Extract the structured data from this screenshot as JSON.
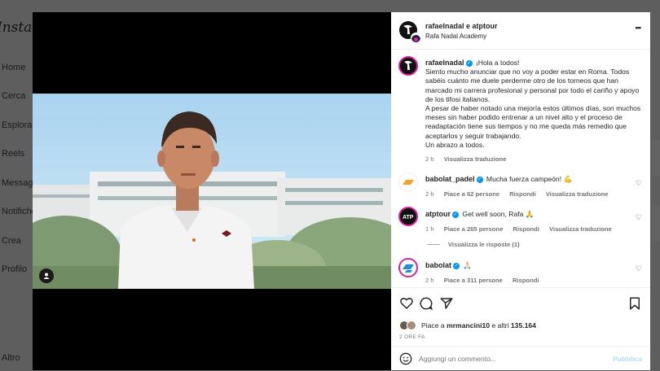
{
  "sidebar": {
    "logo": "Instagram",
    "items": [
      "Home",
      "Cerca",
      "Esplora",
      "Reels",
      "Messaggi",
      "Notifiche",
      "Crea",
      "Profilo",
      "Altro"
    ]
  },
  "post": {
    "author": "rafaelnadal e atptour",
    "location": "Rafa Nadal Academy",
    "more_label": "•••",
    "caption": {
      "user": "rafaelnadal",
      "lines": [
        "¡Hola a todos!",
        "Siento mucho anunciar que no voy a poder estar en Roma. Todos sabéis cuánto me duele perderme otro de los torneos que han marcado mi carrera profesional y personal por todo el cariño y apoyo de los tifosi italianos.",
        "A pesar de haber notado una mejoría estos últimos días, son muchos meses sin haber podido entrenar a un nivel alto y el proceso de readaptación tiene sus tiempos y no me queda más remedio que aceptarlos y seguir trabajando.",
        "Un abrazo a todos."
      ],
      "time": "2 h",
      "translate": "Visualizza traduzione"
    },
    "comments": [
      {
        "user": "babolat_padel",
        "text": "Mucha fuerza campeón! 💪",
        "time": "2 h",
        "likes": "Piace a 62 persone",
        "reply": "Rispondi",
        "translate": "Visualizza traduzione"
      },
      {
        "user": "atptour",
        "text": "Get well soon, Rafa 🙏",
        "time": "1 h",
        "likes": "Piace a 265 persone",
        "reply": "Rispondi",
        "translate": "Visualizza traduzione",
        "view_replies": "Visualizza le risposte (1)"
      },
      {
        "user": "babolat",
        "text": "🙏🏻",
        "time": "2 h",
        "likes": "Piace a 311 persone",
        "reply": "Rispondi"
      }
    ],
    "likes_prefix": "Piace a ",
    "likes_user": "mrmancini10",
    "likes_suffix": " e altri ",
    "likes_count": "135.164",
    "timestamp": "2 ORE FA",
    "add_comment_placeholder": "Aggiungi un commento...",
    "publish": "Pubblica"
  },
  "colors": {
    "accent": "#0095f6",
    "ring": "#d6249f",
    "modal_bg": "#000000",
    "overlay": "#5e5e5e"
  }
}
